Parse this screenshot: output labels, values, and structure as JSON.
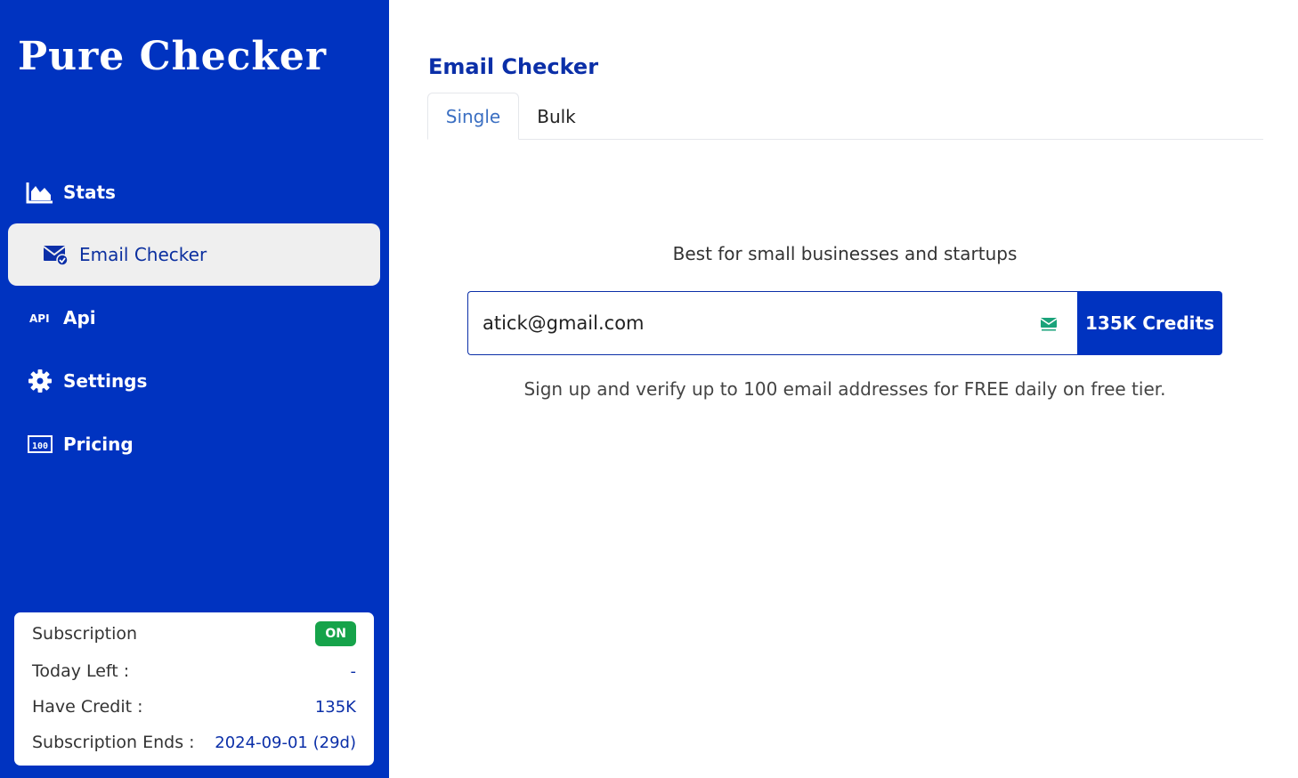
{
  "brand": {
    "name": "Pure Checker"
  },
  "sidebar": {
    "items": [
      {
        "label": "Stats",
        "icon": "area-chart-icon"
      },
      {
        "label": "Email Checker",
        "icon": "mail-check-icon",
        "active": true
      },
      {
        "label": "Api",
        "icon": "api-icon"
      },
      {
        "label": "Settings",
        "icon": "gear-icon"
      },
      {
        "label": "Pricing",
        "icon": "pricing-icon"
      }
    ]
  },
  "subscription": {
    "title": "Subscription",
    "status": "ON",
    "today_left_label": "Today Left :",
    "today_left_value": "-",
    "have_credit_label": "Have Credit :",
    "have_credit_value": "135K",
    "ends_label": "Subscription Ends :",
    "ends_value": "2024-09-01 (29d)"
  },
  "main": {
    "title": "Email Checker",
    "tabs": [
      {
        "label": "Single",
        "active": true
      },
      {
        "label": "Bulk",
        "active": false
      }
    ],
    "tagline": "Best for small businesses and startups",
    "email_value": "atick@gmail.com",
    "credits_button": "135K Credits",
    "note": "Sign up and verify up to 100 email addresses for FREE daily on free tier."
  },
  "colors": {
    "sidebar_bg": "#0033c0",
    "accent": "#0b2fa8",
    "badge_on": "#16a34a",
    "active_item_bg": "#efefef"
  }
}
